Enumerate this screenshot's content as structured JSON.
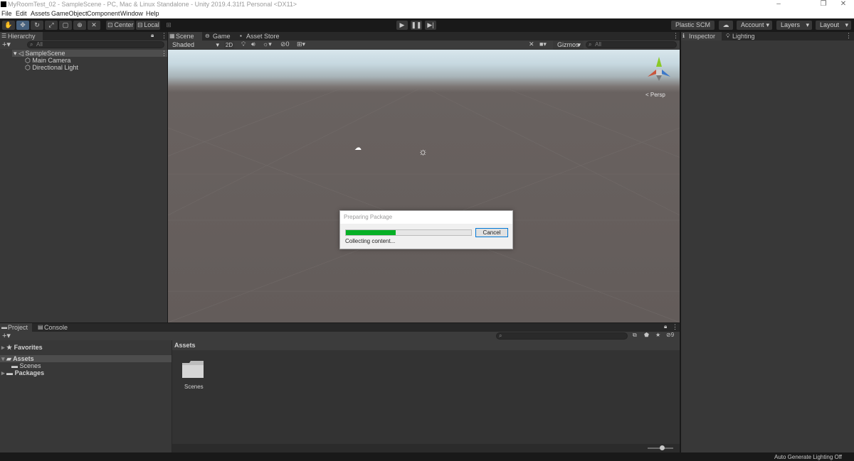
{
  "window": {
    "title": "MyRoomTest_02 - SampleScene - PC, Mac & Linux Standalone - Unity 2019.4.31f1 Personal <DX11>",
    "minimize": "–",
    "restore": "❐",
    "close": "✕"
  },
  "menu": [
    "File",
    "Edit",
    "Assets",
    "GameObject",
    "Component",
    "Window",
    "Help"
  ],
  "toolbar": {
    "tools": [
      "hand-tool",
      "move-tool",
      "rotate-tool",
      "scale-tool",
      "rect-tool",
      "transform-tool",
      "custom-tool"
    ],
    "active_tool": "move-tool",
    "pivot_label": "Center",
    "space_label": "Local",
    "plastic_scm": "Plastic SCM",
    "account": "Account",
    "layers": "Layers",
    "layout": "Layout"
  },
  "hierarchy": {
    "tab": "Hierarchy",
    "search_placeholder": "All",
    "scene": "SampleScene",
    "items": [
      "Main Camera",
      "Directional Light"
    ]
  },
  "scene_tabs": [
    "Scene",
    "Game",
    "Asset Store"
  ],
  "scene_toolbar": {
    "shading": "Shaded",
    "mode_2d": "2D",
    "hidden_count": "0",
    "gizmos": "Gizmos",
    "search_placeholder": "All"
  },
  "scene_view": {
    "persp_label": "< Persp"
  },
  "inspector_tabs": [
    "Inspector",
    "Lighting"
  ],
  "dialog": {
    "title": "Preparing Package",
    "progress_fraction": 0.4,
    "cancel": "Cancel",
    "status": "Collecting content..."
  },
  "project": {
    "tabs": [
      "Project",
      "Console"
    ],
    "hidden_count": "9",
    "favorites": "Favorites",
    "assets": "Assets",
    "scenes": "Scenes",
    "packages": "Packages",
    "breadcrumb": "Assets",
    "folders": [
      "Scenes"
    ]
  },
  "status_bar": {
    "text": "Auto Generate Lighting Off"
  },
  "colors": {
    "accent": "#46607c",
    "progress": "#06b025",
    "dialog_border": "#0078d7"
  }
}
